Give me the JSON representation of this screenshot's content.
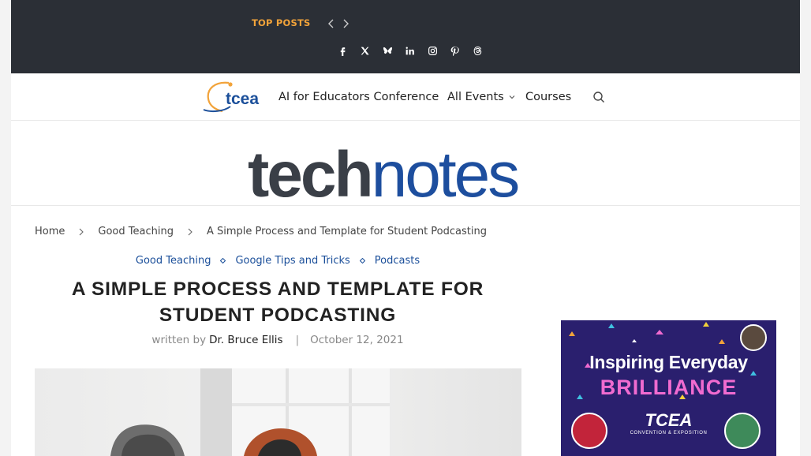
{
  "topbar": {
    "label": "TOP POSTS",
    "socials": [
      "facebook-icon",
      "x-icon",
      "bluesky-icon",
      "linkedin-icon",
      "instagram-icon",
      "pinterest-icon",
      "threads-icon"
    ]
  },
  "nav": {
    "logo_text": "tcea",
    "items": [
      {
        "label": "AI for Educators Conference"
      },
      {
        "label": "All Events"
      },
      {
        "label": "Courses"
      }
    ]
  },
  "masthead": {
    "part1": "tech",
    "part2": "notes"
  },
  "breadcrumb": {
    "home": "Home",
    "category": "Good Teaching",
    "current": "A Simple Process and Template for Student Podcasting"
  },
  "article": {
    "categories": [
      "Good Teaching",
      "Google Tips and Tricks",
      "Podcasts"
    ],
    "title_line1": "A SIMPLE PROCESS AND TEMPLATE FOR",
    "title_line2": "STUDENT PODCASTING",
    "written_by": "written by",
    "author": "Dr. Bruce Ellis",
    "date": "October 12, 2021"
  },
  "ad": {
    "line1": "Inspiring Everyday",
    "line2": "BRILLIANCE",
    "brand": "TCEA",
    "sub": "CONVENTION & EXPOSITION"
  },
  "colors": {
    "topbar": "#2b2f36",
    "accent_orange": "#f2a33a",
    "link_blue": "#1b4f9a",
    "ad_purple": "#2a1f6e"
  }
}
